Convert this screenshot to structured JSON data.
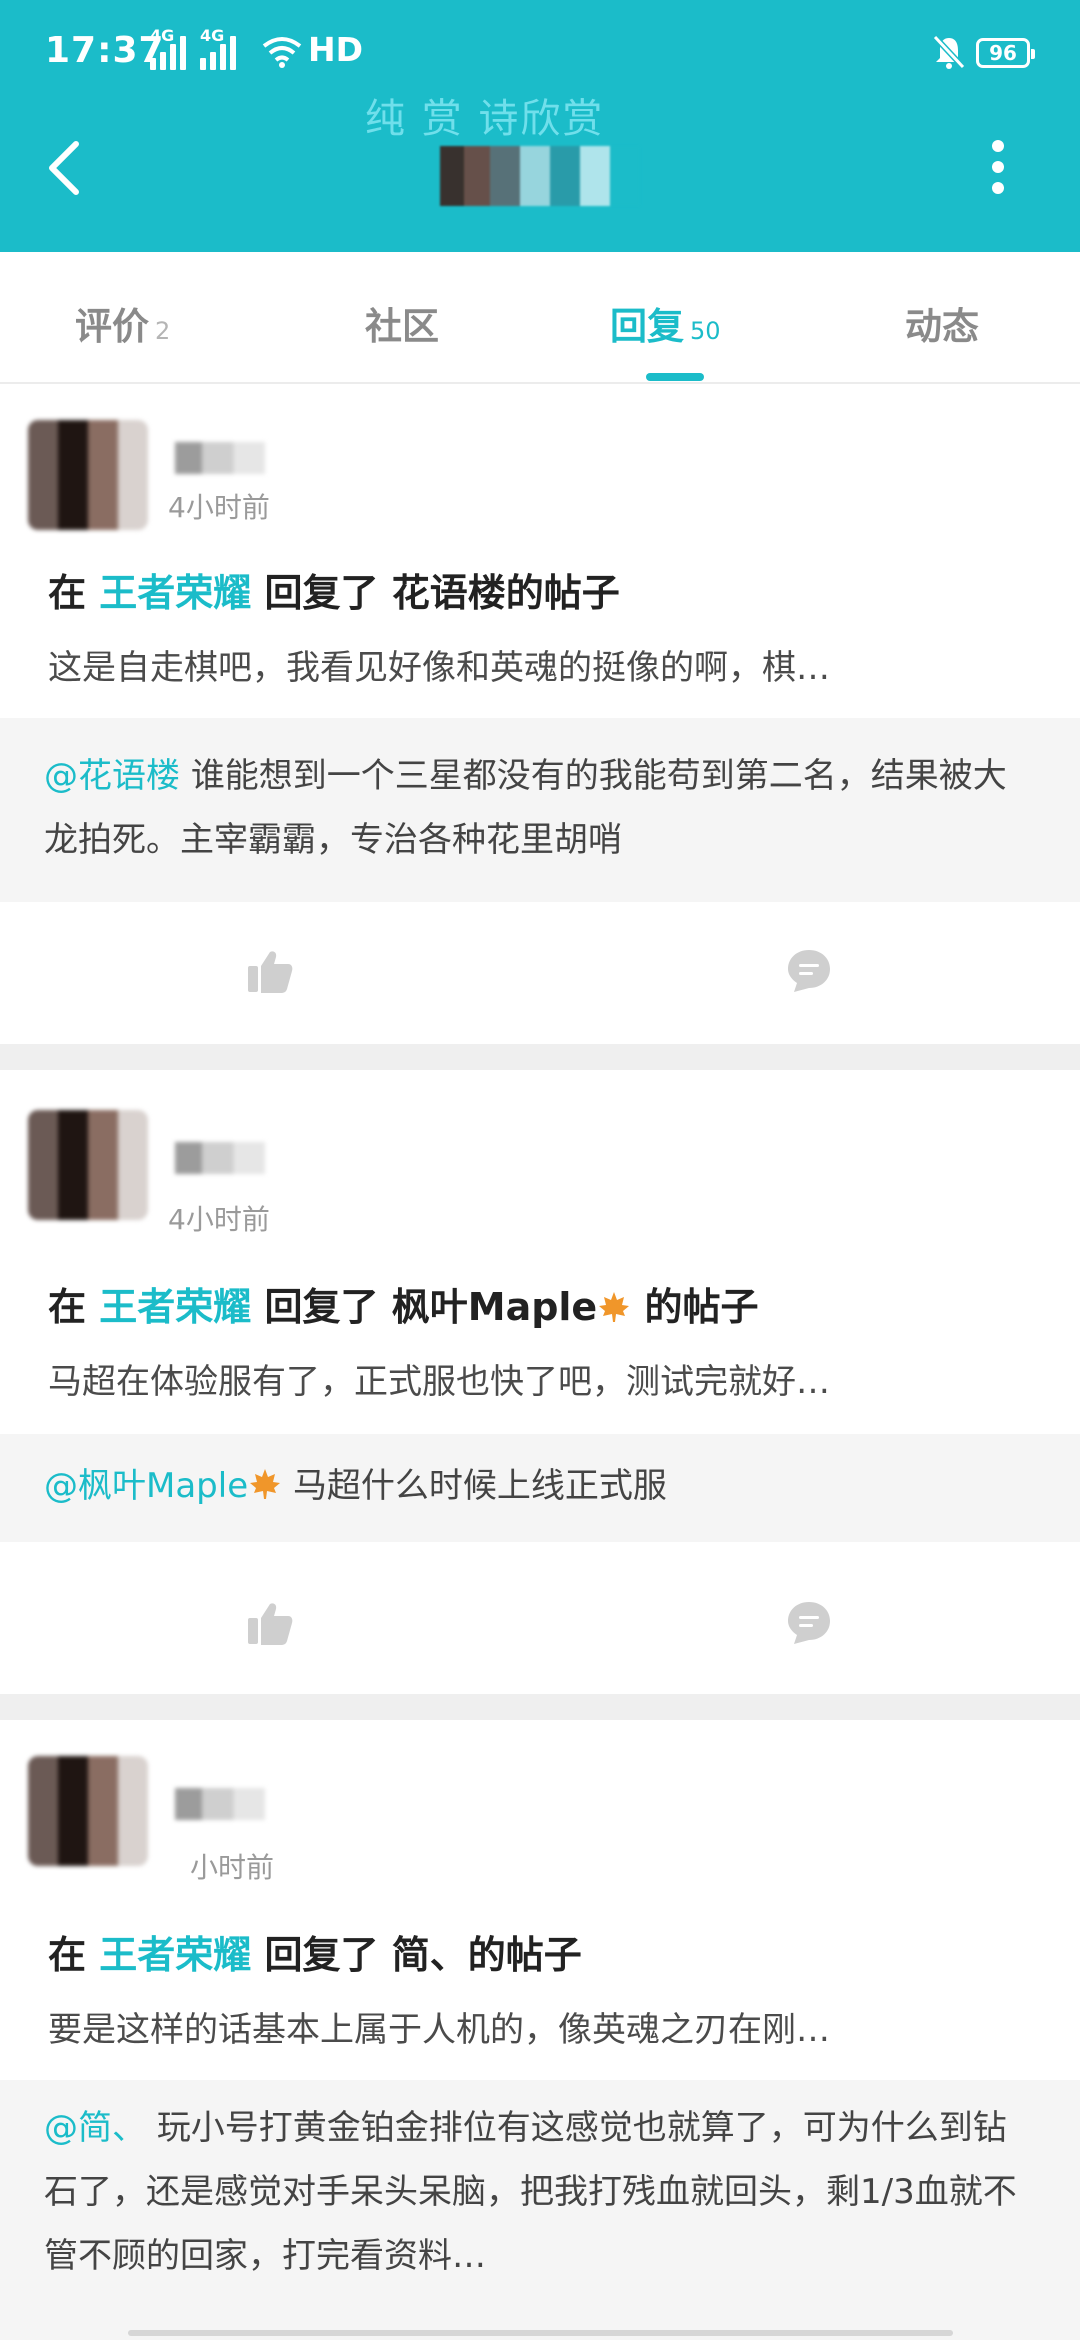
{
  "status_bar": {
    "time": "17:37",
    "sim1": "4G",
    "sim2": "4G",
    "hd": "HD",
    "battery": "96"
  },
  "header": {
    "title": "纯 赏 诗欣赏"
  },
  "tabs": [
    {
      "label": "评价",
      "count": "2",
      "active": false
    },
    {
      "label": "社区",
      "count": "",
      "active": false
    },
    {
      "label": "回复",
      "count": "50",
      "active": true
    },
    {
      "label": "动态",
      "count": "",
      "active": false
    }
  ],
  "posts": [
    {
      "time_ago": "4小时前",
      "prefix": "在",
      "forum": "王者荣耀",
      "mid": "回复了",
      "target": "花语楼",
      "suffix": "的帖子",
      "excerpt": "这是自走棋吧，我看见好像和英魂的挺像的啊，棋…",
      "quote_user": "@花语楼",
      "quote_text": "谁能想到一个三星都没有的我能苟到第二名，结果被大龙拍死。主宰霸霸，专治各种花里胡哨"
    },
    {
      "time_ago": "4小时前",
      "prefix": "在",
      "forum": "王者荣耀",
      "mid": "回复了",
      "target": "枫叶Maple",
      "suffix": "的帖子",
      "excerpt": "马超在体验服有了，正式服也快了吧，测试完就好…",
      "quote_user": "@枫叶Maple",
      "quote_text": "马超什么时候上线正式服"
    },
    {
      "time_ago": "小时前",
      "prefix": "在",
      "forum": "王者荣耀",
      "mid": "回复了",
      "target": "简、",
      "suffix": "的帖子",
      "excerpt": "要是这样的话基本上属于人机的，像英魂之刃在刚…",
      "quote_user": "@简、",
      "quote_text": "玩小号打黄金铂金排位有这感觉也就算了，可为什么到钻石了，还是感觉对手呆头呆脑，把我打残血就回头，剩1/3血就不管不顾的回家，打完看资料…"
    }
  ],
  "colors": {
    "accent": "#1bbcc9",
    "separator": "#efefef",
    "quote_bg": "#f5f5f5"
  }
}
